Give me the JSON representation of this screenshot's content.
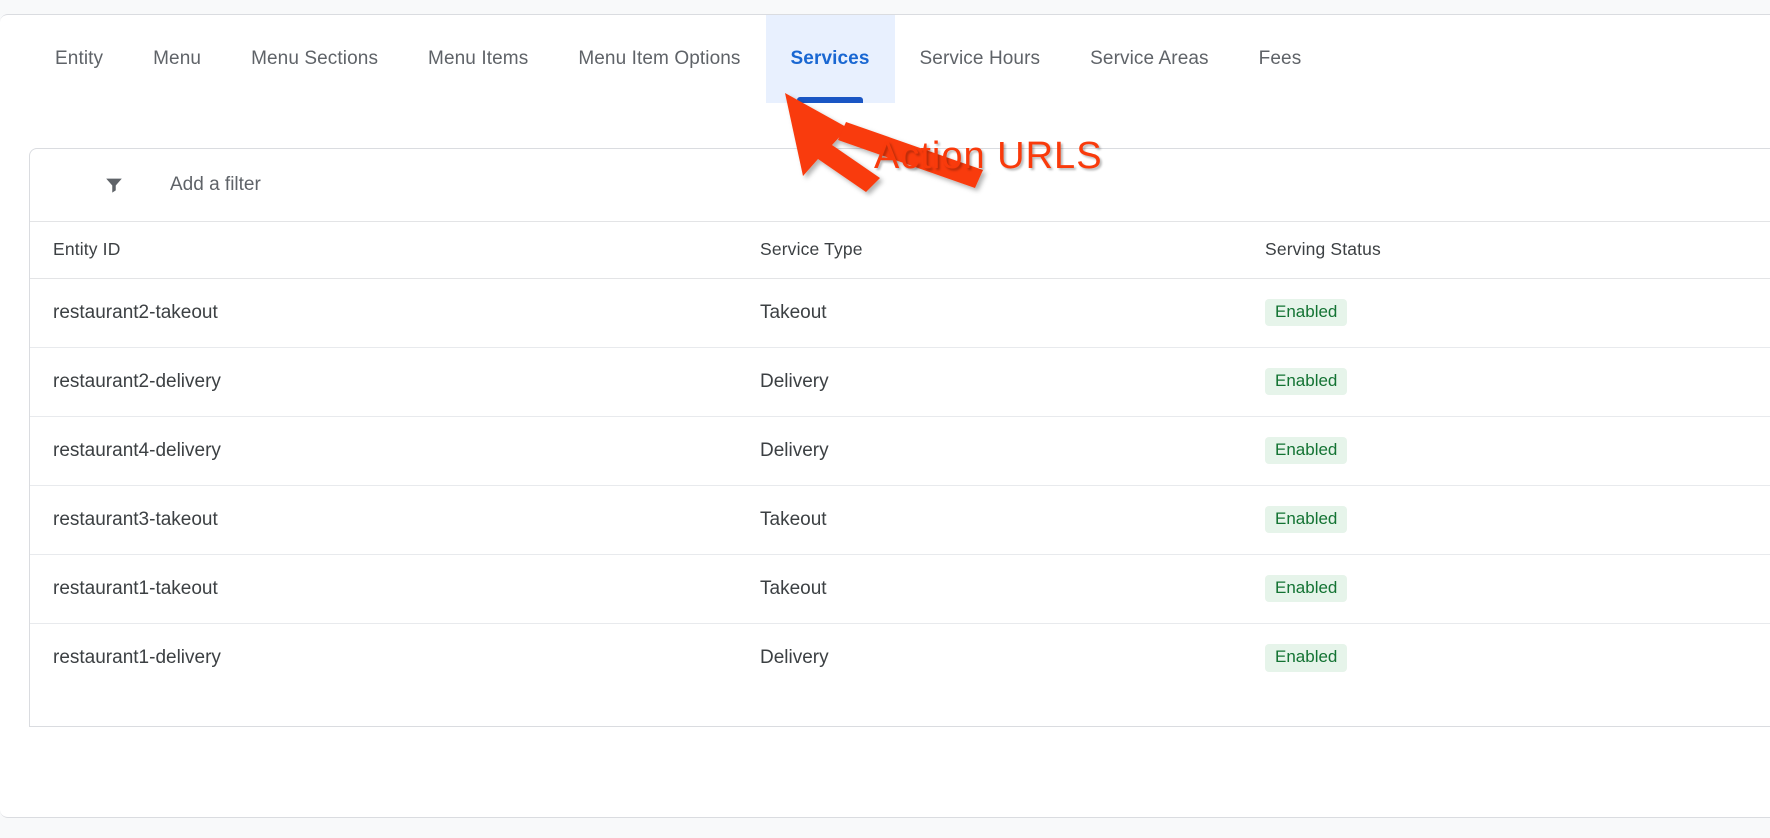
{
  "tabs": [
    {
      "label": "Entity",
      "active": false
    },
    {
      "label": "Menu",
      "active": false
    },
    {
      "label": "Menu Sections",
      "active": false
    },
    {
      "label": "Menu Items",
      "active": false
    },
    {
      "label": "Menu Item Options",
      "active": false
    },
    {
      "label": "Services",
      "active": true
    },
    {
      "label": "Service Hours",
      "active": false
    },
    {
      "label": "Service Areas",
      "active": false
    },
    {
      "label": "Fees",
      "active": false
    }
  ],
  "filter": {
    "icon": "filter-funnel-icon",
    "placeholder": "Add a filter",
    "value": ""
  },
  "table": {
    "columns": [
      "Entity ID",
      "Service Type",
      "Serving Status"
    ],
    "rows": [
      {
        "entity_id": "restaurant2-takeout",
        "service_type": "Takeout",
        "serving_status": "Enabled"
      },
      {
        "entity_id": "restaurant2-delivery",
        "service_type": "Delivery",
        "serving_status": "Enabled"
      },
      {
        "entity_id": "restaurant4-delivery",
        "service_type": "Delivery",
        "serving_status": "Enabled"
      },
      {
        "entity_id": "restaurant3-takeout",
        "service_type": "Takeout",
        "serving_status": "Enabled"
      },
      {
        "entity_id": "restaurant1-takeout",
        "service_type": "Takeout",
        "serving_status": "Enabled"
      },
      {
        "entity_id": "restaurant1-delivery",
        "service_type": "Delivery",
        "serving_status": "Enabled"
      }
    ]
  },
  "annotation": {
    "label": "Action URLS",
    "color": "#f93a0b",
    "arrow": "arrow-pointing-to-services-tab"
  },
  "colors": {
    "accent_blue": "#1967d2",
    "active_tab_bg": "#e8f0fe",
    "tab_underline": "#1a56c4",
    "badge_bg": "#e6f4ea",
    "badge_text": "#137333",
    "page_bg": "#f8f9fa",
    "border": "#dadce0"
  }
}
